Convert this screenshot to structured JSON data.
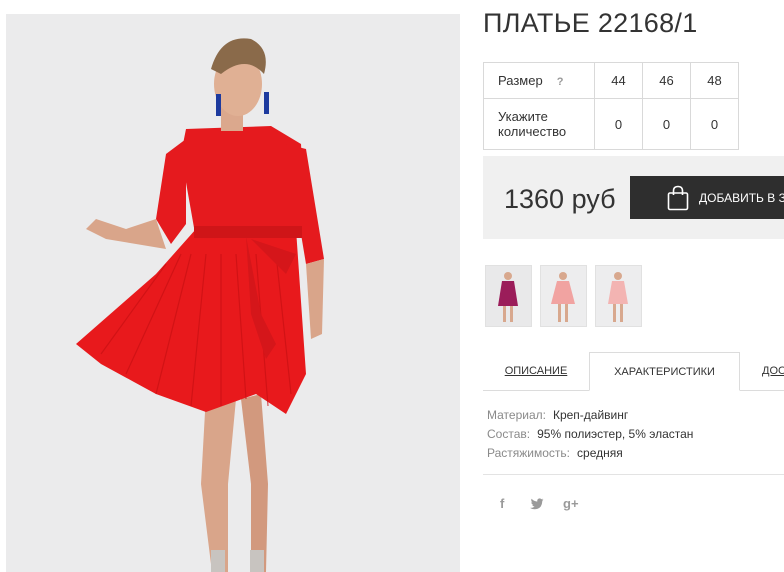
{
  "product": {
    "title": "ПЛАТЬЕ 22168/1"
  },
  "sizes_table": {
    "size_label": "Размер",
    "help_mark": "?",
    "sizes": [
      "44",
      "46",
      "48"
    ],
    "quantity_label": "Укажите количество",
    "quantities": [
      "0",
      "0",
      "0"
    ]
  },
  "price": {
    "value": "1360 руб",
    "add_button": "ДОБАВИТЬ В З"
  },
  "thumbnails": [
    {
      "name": "thumb-magenta",
      "color": "#9b1d5a"
    },
    {
      "name": "thumb-pink",
      "color": "#f1a3a1"
    },
    {
      "name": "thumb-peach",
      "color": "#f3b4b2"
    }
  ],
  "tabs": [
    {
      "label": "ОПИСАНИЕ"
    },
    {
      "label": "ХАРАКТЕРИСТИКИ",
      "active": true
    },
    {
      "label": "ДОС"
    }
  ],
  "characteristics": [
    {
      "key": "Материал:",
      "value": "Креп-дайвинг"
    },
    {
      "key": "Состав:",
      "value": "95% полиэстер, 5% эластан"
    },
    {
      "key": "Растяжимость:",
      "value": "средняя"
    }
  ],
  "social": {
    "facebook": "f",
    "twitter": "twitter-icon",
    "google_plus": "g+"
  },
  "colors": {
    "dress": "#e8191c",
    "button": "#2e2e2e",
    "price_bg": "#f0f0f0"
  }
}
